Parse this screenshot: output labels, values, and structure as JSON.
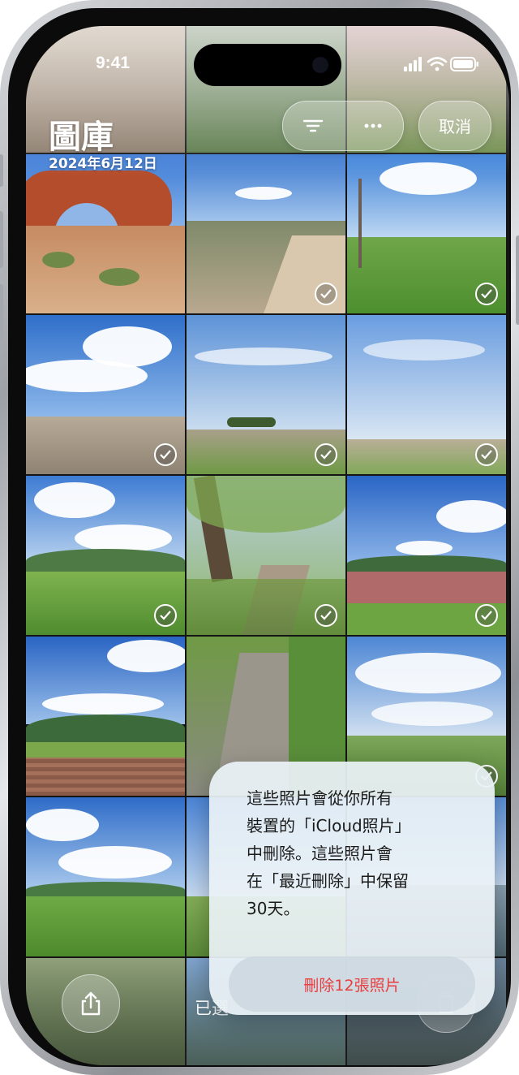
{
  "status_bar": {
    "time": "9:41"
  },
  "header": {
    "title": "圖庫",
    "date": "2024年6月12日"
  },
  "toolbar_top": {
    "filter_icon": "filter-icon",
    "more_icon": "more-icon",
    "cancel_label": "取消"
  },
  "photos": [
    {
      "name": "red-rock-arch",
      "selected": false
    },
    {
      "name": "sand-dune-path",
      "selected": true
    },
    {
      "name": "green-meadow-dead-tree",
      "selected": true
    },
    {
      "name": "beach-clouds",
      "selected": true
    },
    {
      "name": "field-trees-horizon",
      "selected": true
    },
    {
      "name": "wide-field-sky",
      "selected": true
    },
    {
      "name": "meadow-hills",
      "selected": true
    },
    {
      "name": "woodland-trail",
      "selected": true
    },
    {
      "name": "red-field-hill",
      "selected": true
    },
    {
      "name": "farmland-mountain",
      "selected": true
    },
    {
      "name": "rocky-path",
      "selected": true
    },
    {
      "name": "cloudy-valley",
      "selected": true
    },
    {
      "name": "green-pasture",
      "selected": true
    },
    {
      "name": "sky-field",
      "selected": true
    },
    {
      "name": "lake-shore",
      "selected": true
    }
  ],
  "bottom_bar": {
    "share_icon": "share-icon",
    "selected_text": "已選",
    "trash_icon": "trash-icon"
  },
  "popup": {
    "message": "這些照片會從你所有\n裝置的「iCloud照片」\n中刪除。這些照片會\n在「最近刪除」中保留\n30天。",
    "delete_label": "刪除12張照片"
  },
  "colors": {
    "destructive": "#ea3d3d",
    "white": "#ffffff"
  }
}
